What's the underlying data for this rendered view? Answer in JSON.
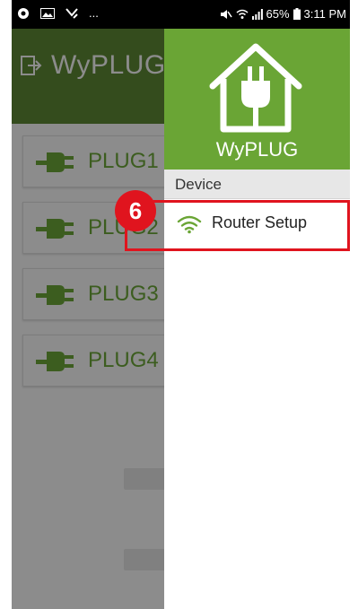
{
  "status_bar": {
    "battery": "65%",
    "time": "3:11 PM",
    "left_ellipsis": "..."
  },
  "background_app": {
    "title": "WyPLUG",
    "plugs": [
      "PLUG1",
      "PLUG2",
      "PLUG3",
      "PLUG4"
    ]
  },
  "drawer": {
    "brand": "WyPLUG",
    "section": "Device",
    "items": [
      {
        "label": "Router Setup",
        "icon": "wifi-icon"
      }
    ]
  },
  "annotation": {
    "step_number": "6"
  },
  "colors": {
    "header_green": "#6aa535",
    "app_bar_green": "#5f8a36",
    "plug_green": "#6da93a",
    "annotation_red": "#e0141e"
  }
}
